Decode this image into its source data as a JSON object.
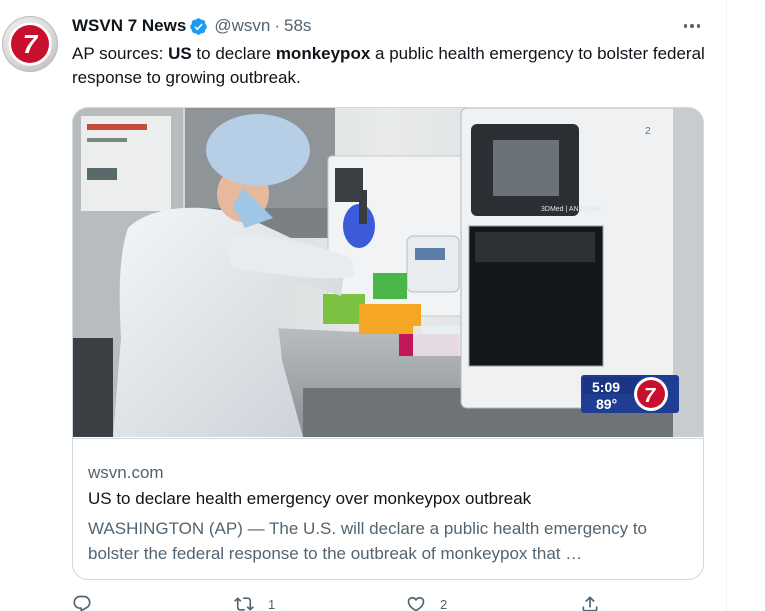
{
  "tweet": {
    "author_name": "WSVN 7 News",
    "handle": "@wsvn",
    "separator": "·",
    "time": "58s",
    "avatar_glyph": "7",
    "text_parts": [
      "AP sources: ",
      "US",
      " to declare ",
      "monkeypox",
      " a public health emergency to bolster federal response to growing outbreak."
    ]
  },
  "card": {
    "domain": "wsvn.com",
    "title": "US to declare health emergency over monkeypox outbreak",
    "description": "WASHINGTON (AP) — The U.S. will declare a public health emergency to bolster the federal response to the outbreak of monkeypox that …",
    "image": {
      "bug_time": "5:09",
      "bug_temp": "89°",
      "bug_logo": "7",
      "machine_brand": "3DMed | ANDIS350",
      "machine_number": "2"
    }
  },
  "actions": {
    "reply_count": "",
    "retweet_count": "1",
    "like_count": "2"
  },
  "icons": {
    "verified": "verified-badge-icon",
    "more": "more-options-icon",
    "reply": "reply-icon",
    "retweet": "retweet-icon",
    "like": "like-icon",
    "share": "share-icon"
  },
  "colors": {
    "verified_blue": "#1d9bf0",
    "secondary_text": "#536471",
    "border": "#cfd9de",
    "brand_red": "#c8102e"
  }
}
